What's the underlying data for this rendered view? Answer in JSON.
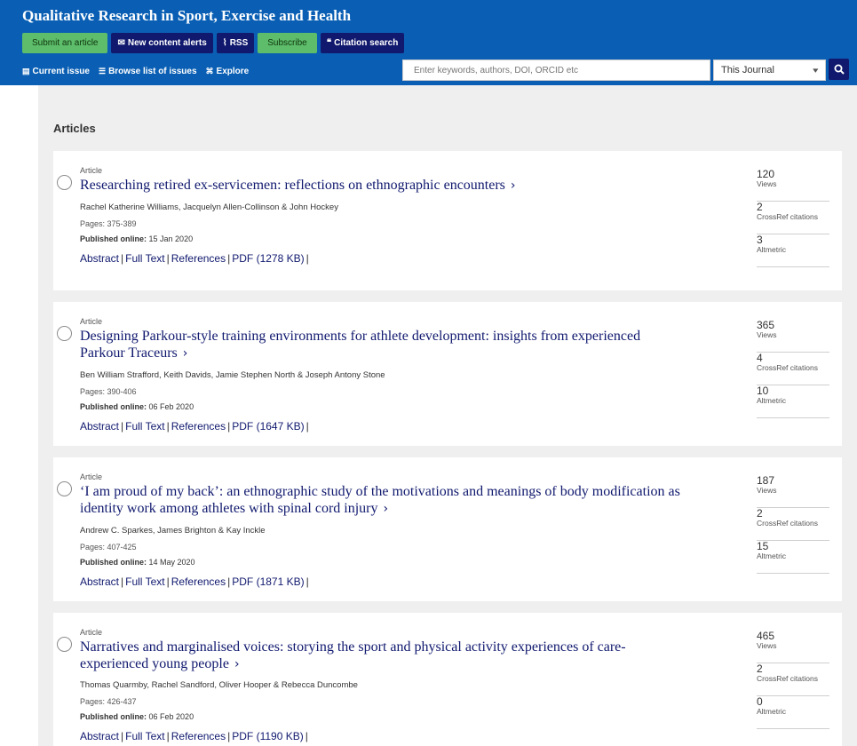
{
  "header": {
    "journal_title": "Qualitative Research in Sport, Exercise and Health",
    "buttons": {
      "submit": "Submit an article",
      "alerts": "New content alerts",
      "rss": "RSS",
      "subscribe": "Subscribe",
      "citation": "Citation search"
    },
    "nav": {
      "current_issue": "Current issue",
      "browse": "Browse list of issues",
      "explore": "Explore"
    },
    "search": {
      "placeholder": "Enter keywords, authors, DOI, ORCID etc",
      "scope": "This Journal"
    },
    "colors": {
      "bar": "#0a5fb4",
      "green_button": "#5dbd6a",
      "navy_button": "#10196e"
    }
  },
  "section_heading": "Articles",
  "metric_labels": {
    "views": "Views",
    "citations": "CrossRef citations",
    "altmetric": "Altmetric"
  },
  "articles": [
    {
      "type": "Article",
      "title": "Researching retired ex-servicemen: reflections on ethnographic encounters",
      "authors": "Rachel Katherine Williams, Jacquelyn Allen-Collinson & John Hockey",
      "pages": "Pages: 375-389",
      "published_label": "Published online:",
      "published_date": "15 Jan 2020",
      "links": {
        "abstract": "Abstract",
        "fulltext": "Full Text",
        "references": "References",
        "pdf": "PDF (1278 KB)"
      },
      "views": "120",
      "citations": "2",
      "altmetric": "3"
    },
    {
      "type": "Article",
      "title": "Designing Parkour-style training environments for athlete development: insights from experienced Parkour Traceurs",
      "authors": "Ben William Strafford, Keith Davids, Jamie Stephen North & Joseph Antony Stone",
      "pages": "Pages: 390-406",
      "published_label": "Published online:",
      "published_date": "06 Feb 2020",
      "links": {
        "abstract": "Abstract",
        "fulltext": "Full Text",
        "references": "References",
        "pdf": "PDF (1647 KB)"
      },
      "views": "365",
      "citations": "4",
      "altmetric": "10"
    },
    {
      "type": "Article",
      "title": "‘I am proud of my back’: an ethnographic study of the motivations and meanings of body modification as identity work among athletes with spinal cord injury",
      "authors": "Andrew C. Sparkes, James Brighton & Kay Inckle",
      "pages": "Pages: 407-425",
      "published_label": "Published online:",
      "published_date": "14 May 2020",
      "links": {
        "abstract": "Abstract",
        "fulltext": "Full Text",
        "references": "References",
        "pdf": "PDF (1871 KB)"
      },
      "views": "187",
      "citations": "2",
      "altmetric": "15"
    },
    {
      "type": "Article",
      "title": "Narratives and marginalised voices: storying the sport and physical activity experiences of care-experienced young people",
      "authors": "Thomas Quarmby, Rachel Sandford, Oliver Hooper & Rebecca Duncombe",
      "pages": "Pages: 426-437",
      "published_label": "Published online:",
      "published_date": "06 Feb 2020",
      "links": {
        "abstract": "Abstract",
        "fulltext": "Full Text",
        "references": "References",
        "pdf": "PDF (1190 KB)"
      },
      "views": "465",
      "citations": "2",
      "altmetric": "0"
    }
  ]
}
